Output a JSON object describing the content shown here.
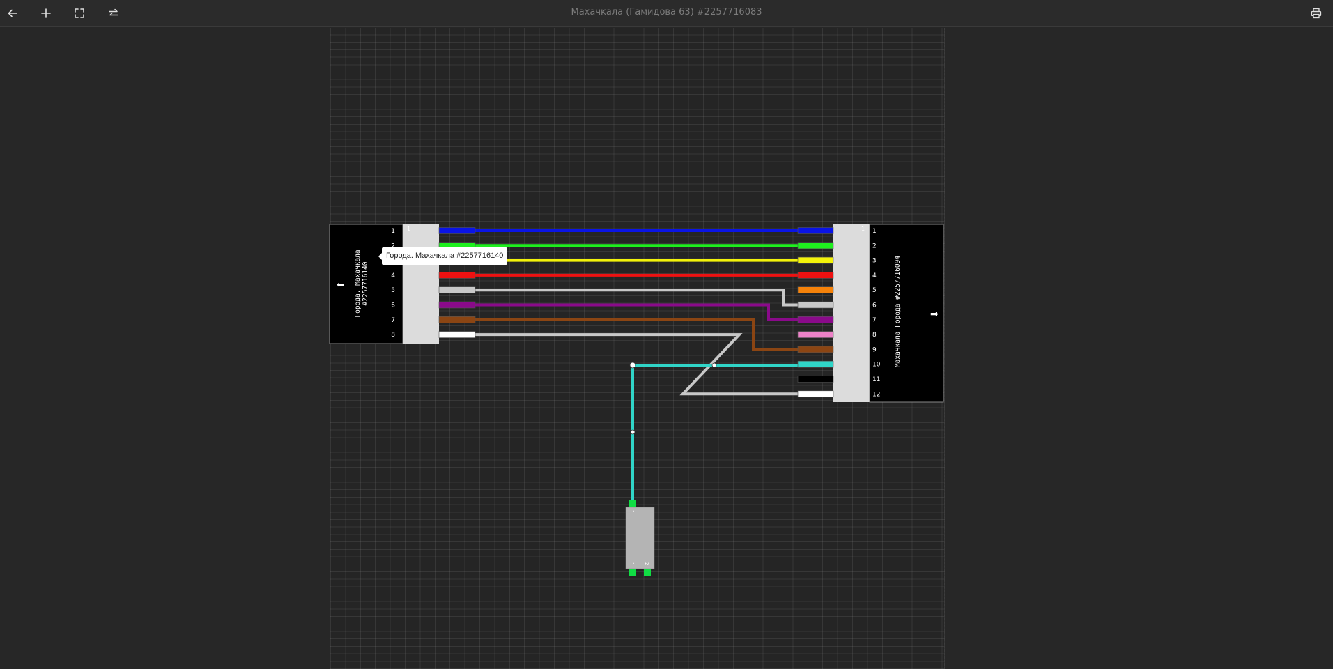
{
  "header": {
    "title": "Махачкала (Гамидова 63) #2257716083",
    "back_icon": "arrow-left-icon",
    "add_icon": "plus-icon",
    "fullscreen_icon": "fullscreen-icon",
    "swap_icon": "swap-arrows-icon",
    "print_icon": "printer-icon"
  },
  "left_cable": {
    "label_line1": "Города. Махачкала",
    "label_line2": "#2257716140",
    "arrow": "⬅",
    "port_numbers": [
      "1",
      "2",
      "3",
      "4",
      "5",
      "6",
      "7",
      "8"
    ],
    "splice_box_index": "1"
  },
  "right_cable": {
    "label": "Махачкала Города #2257716094",
    "arrow": "➡",
    "port_numbers": [
      "1",
      "2",
      "3",
      "4",
      "5",
      "6",
      "7",
      "8",
      "9",
      "10",
      "11",
      "12"
    ],
    "splice_box_index": "1"
  },
  "splitter": {
    "input_label": "1",
    "output_labels": [
      "1",
      "2"
    ]
  },
  "tooltip": {
    "text": "Города. Махачкала #2257716140"
  },
  "colors": {
    "blue": "#0a14e6",
    "green": "#1ef01e",
    "yellow": "#f2f20a",
    "red": "#ee1111",
    "orange": "#f5820a",
    "gray": "#c8c8c8",
    "violet": "#8a0a8a",
    "pink": "#ee82c8",
    "brown": "#8b4513",
    "cyan": "#30d5c8",
    "black": "#000000",
    "white": "#ffffff",
    "connector_green": "#11dd44"
  }
}
